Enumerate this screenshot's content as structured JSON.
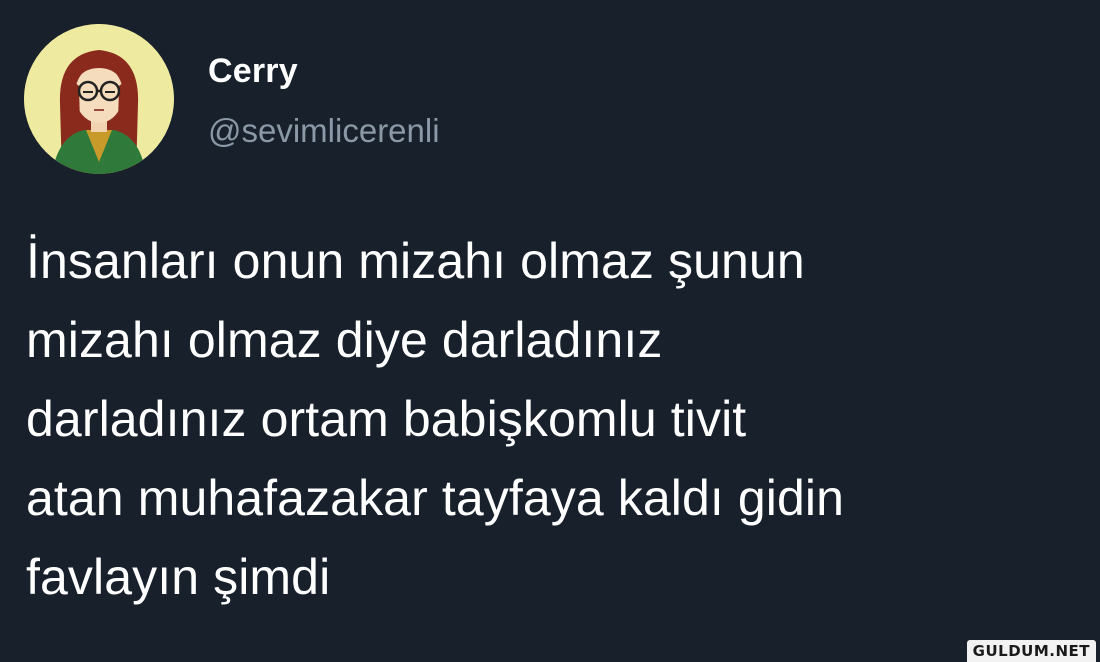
{
  "author": {
    "display_name": "Cerry",
    "handle": "@sevimlicerenli",
    "avatar_icon": "cartoon-avatar-icon"
  },
  "tweet": {
    "lines": [
      "İnsanları onun mizahı olmaz şunun",
      "mizahı olmaz diye darladınız",
      "darladınız ortam babişkomlu tivit",
      "atan muhafazakar tayfaya kaldı gidin",
      "favlayın şimdi"
    ]
  },
  "watermark": {
    "text": "GULDUM.NET"
  },
  "colors": {
    "background": "#17202b",
    "primary_text": "#ffffff",
    "secondary_text": "#8b98a5",
    "avatar_background": "#eeeaa0"
  }
}
